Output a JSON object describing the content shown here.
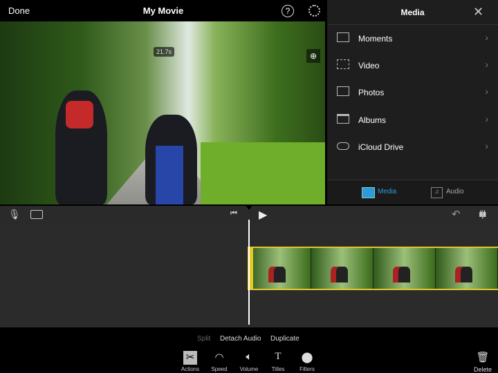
{
  "header": {
    "done": "Done",
    "title": "My Movie",
    "help": "?"
  },
  "video": {
    "duration": "21.7s"
  },
  "media": {
    "title": "Media",
    "close": "✕",
    "items": [
      {
        "label": "Moments"
      },
      {
        "label": "Video"
      },
      {
        "label": "Photos"
      },
      {
        "label": "Albums"
      },
      {
        "label": "iCloud Drive"
      }
    ],
    "tabs": [
      {
        "label": "Media",
        "active": true
      },
      {
        "label": "Audio"
      }
    ],
    "accent": "#2f9bd6"
  },
  "actions": {
    "split": "Split",
    "detach": "Detach Audio",
    "duplicate": "Duplicate"
  },
  "tools": [
    {
      "label": "Actions"
    },
    {
      "label": "Speed"
    },
    {
      "label": "Volume"
    },
    {
      "label": "Titles"
    },
    {
      "label": "Filters"
    }
  ],
  "delete": "Delete",
  "clip_highlight": "#e5c82a"
}
